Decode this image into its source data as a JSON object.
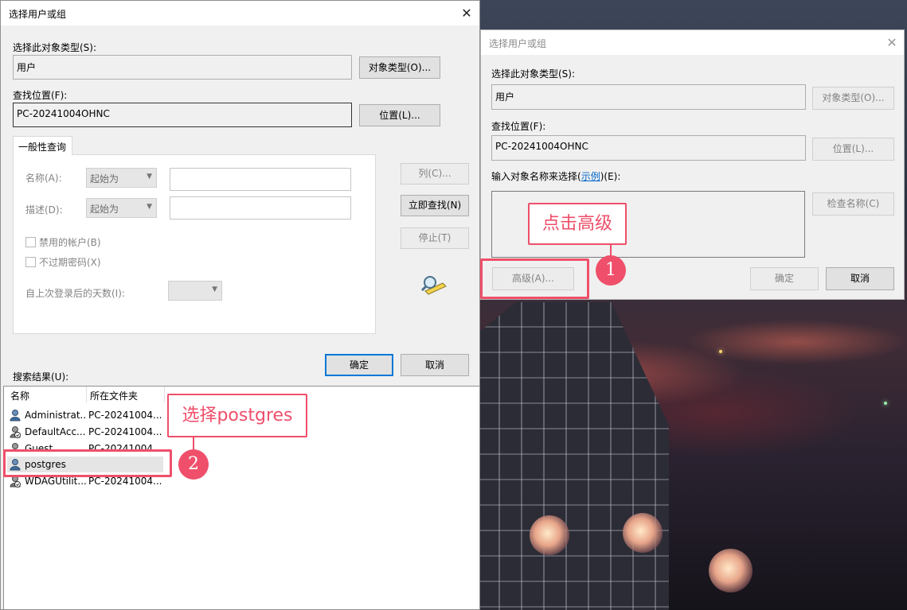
{
  "left_dialog": {
    "title": "选择用户或组",
    "object_type_label": "选择此对象类型(S):",
    "object_type_value": "用户",
    "object_types_button": "对象类型(O)...",
    "location_label": "查找位置(F):",
    "location_value": "PC-20241004OHNC",
    "location_button": "位置(L)...",
    "tab_label": "一般性查询",
    "name_label": "名称(A):",
    "name_combo": "起始为",
    "description_label": "描述(D):",
    "description_combo": "起始为",
    "columns_button": "列(C)...",
    "find_now_button": "立即查找(N)",
    "stop_button": "停止(T)",
    "disabled_accounts": "禁用的帐户(B)",
    "non_expiring_password": "不过期密码(X)",
    "days_since_logon_label": "自上次登录后的天数(I):",
    "ok_button": "确定",
    "cancel_button": "取消",
    "results_label": "搜索结果(U):",
    "results_columns": [
      "名称",
      "所在文件夹"
    ],
    "results_rows": [
      {
        "name": "Administrat...",
        "folder": "PC-20241004..."
      },
      {
        "name": "DefaultAcc...",
        "folder": "PC-20241004..."
      },
      {
        "name": "Guest",
        "folder": "PC-20241004..."
      },
      {
        "name": "postgres",
        "folder": ""
      },
      {
        "name": "WDAGUtilit...",
        "folder": "PC-20241004..."
      }
    ]
  },
  "right_dialog": {
    "title": "选择用户或组",
    "object_type_label": "选择此对象类型(S):",
    "object_type_value": "用户",
    "object_types_button": "对象类型(O)...",
    "location_label": "查找位置(F):",
    "location_value": "PC-20241004OHNC",
    "location_button": "位置(L)...",
    "enter_names_label_pre": "输入对象名称来选择(",
    "enter_names_link": "示例",
    "enter_names_label_post": ")(E):",
    "check_names_button": "检查名称(C)",
    "advanced_button": "高级(A)...",
    "ok_button": "确定",
    "cancel_button": "取消"
  },
  "annotations": {
    "step1_text": "点击高级",
    "step1_number": "1",
    "step2_text": "选择postgres",
    "step2_number": "2",
    "color": "#ef4f6a"
  }
}
